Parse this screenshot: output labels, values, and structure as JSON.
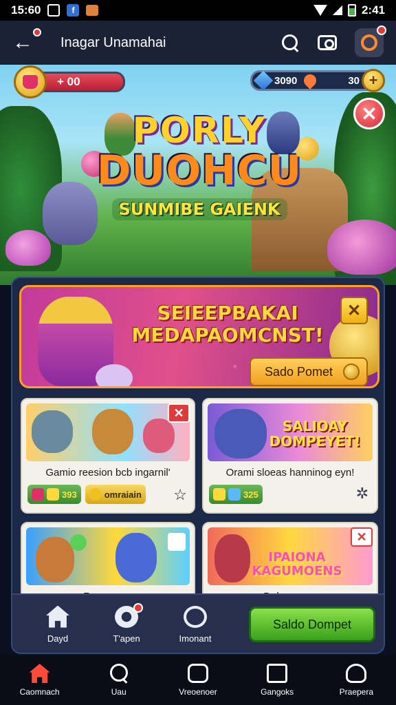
{
  "status_bar": {
    "time_left": "15:60",
    "time_right": "2:41"
  },
  "app_bar": {
    "title": "Inagar Unamahai",
    "back_icon": "arrow-left-icon",
    "search_icon": "search-icon",
    "camera_icon": "camera-icon",
    "profile_icon": "profile-ring-icon"
  },
  "hud": {
    "left_value": "+ 00",
    "gems_value": "3090",
    "hearts_value": "30"
  },
  "hero": {
    "logo_line1": "PORLY",
    "logo_line2": "DUOHCU",
    "logo_line3": "SUNMIBE GAIENK"
  },
  "promo_banner": {
    "headline": "SEIEEPBAKAI MEDAPAOMCNST!",
    "cta_label": "Sado Pomet"
  },
  "cards": [
    {
      "caption": "Gamio reesion bcb ingarnil'",
      "stat1": "393",
      "stat2": "omraiain"
    },
    {
      "art_text": "SALIOAY DOMPEYET!",
      "caption": "Orami sloeas hanninog eyn!",
      "stat1": "325"
    },
    {
      "caption": "Rossmoan"
    },
    {
      "art_text": "IPAIONA KAGUMOENS",
      "caption": "Dabsroame"
    }
  ],
  "action_row": {
    "item1": "Dayd",
    "item2": "T'apen",
    "item3": "Imonant",
    "primary_button": "Saldo Dompet"
  },
  "bottom_nav": [
    {
      "label": "Caomnach",
      "icon": "home-icon"
    },
    {
      "label": "Uau",
      "icon": "search-icon"
    },
    {
      "label": "Vreoenoer",
      "icon": "face-icon"
    },
    {
      "label": "Gangoks",
      "icon": "briefcase-icon"
    },
    {
      "label": "Praepera",
      "icon": "person-icon"
    }
  ],
  "colors": {
    "appbar": "#1c2235",
    "panel": "#1b2848",
    "accent_green": "#3aa01a",
    "accent_orange": "#ffa020",
    "nav_active": "#ff4a3a"
  }
}
